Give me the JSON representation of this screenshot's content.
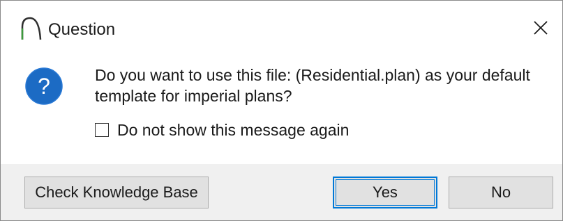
{
  "window": {
    "title": "Question",
    "app_icon": "arch-curve-icon",
    "close_icon": "close-icon"
  },
  "dialog": {
    "icon": "question-icon",
    "message": "Do you want to use this file: (Residential.plan) as your default template for imperial plans?",
    "checkbox": {
      "label": "Do not show this message again",
      "checked": false
    }
  },
  "buttons": {
    "knowledge_base": "Check Knowledge Base",
    "yes": "Yes",
    "no": "No"
  },
  "colors": {
    "question_icon_fill": "#1c6bc4",
    "app_icon_stroke": "#2e8b2e",
    "footer_bg": "#f0f0f0",
    "focus_border": "#0078d7"
  }
}
